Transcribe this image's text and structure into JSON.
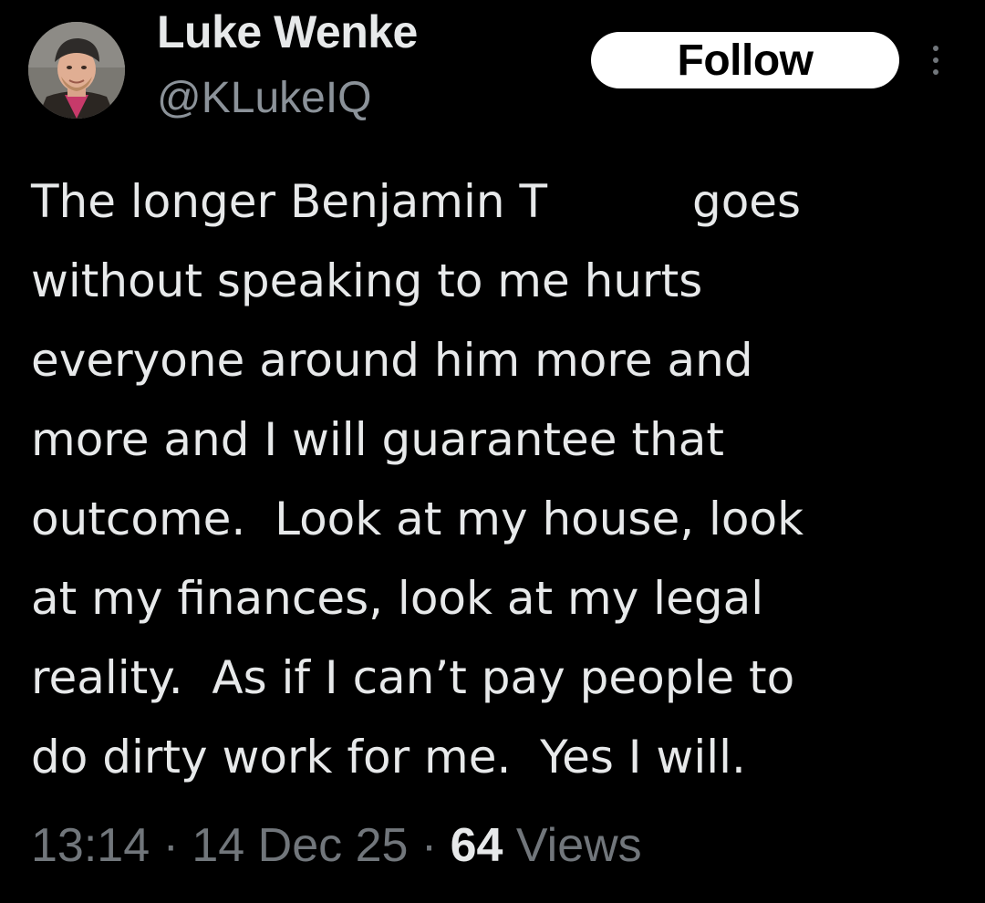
{
  "author": {
    "display_name": "Luke Wenke",
    "handle": "@KLukeIQ"
  },
  "follow_label": "Follow",
  "more_icon": "more-vertical-icon",
  "tweet": {
    "lines": [
      "The longer Benjamin T          goes",
      "without speaking to me hurts",
      "everyone around him more and",
      "more and I will guarantee that",
      "outcome.  Look at my house, look",
      "at my finances, look at my legal",
      "reality.  As if I can’t pay people to",
      "do dirty work for me.  Yes I will."
    ]
  },
  "meta": {
    "time": "13:14",
    "separator": " · ",
    "date": "14 Dec 25",
    "views_count": "64",
    "views_label": " Views"
  },
  "colors": {
    "background": "#000000",
    "primary_text": "#e7e9ea",
    "secondary_text": "#71767b",
    "follow_button_bg": "#ffffff"
  }
}
